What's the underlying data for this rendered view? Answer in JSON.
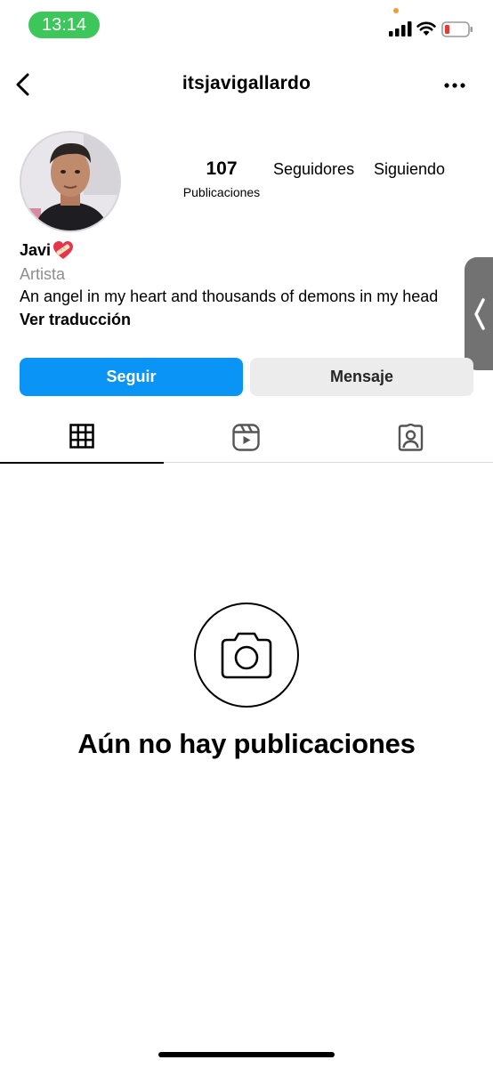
{
  "status_bar": {
    "time": "13:14",
    "colors": {
      "time_pill": "#3dc75a",
      "battery_low": "#e53935"
    }
  },
  "header": {
    "username": "itsjavigallardo",
    "back_icon": "chevron-left-icon",
    "more_icon": "more-horizontal-icon"
  },
  "profile": {
    "posts_count": "107",
    "posts_label": "Publicaciones",
    "followers_label": "Seguidores",
    "following_label": "Siguiendo",
    "display_name": "Javi",
    "display_name_emoji": "heart-with-bandage-icon",
    "category": "Artista",
    "bio": "An angel in my heart and thousands of demons in my head",
    "translate_link": "Ver traducción"
  },
  "actions": {
    "follow_label": "Seguir",
    "message_label": "Mensaje",
    "colors": {
      "follow_bg": "#0a95f6",
      "message_bg": "#ececec"
    }
  },
  "tabs": [
    {
      "icon": "grid-icon",
      "active": true
    },
    {
      "icon": "reels-icon",
      "active": false
    },
    {
      "icon": "tagged-icon",
      "active": false
    }
  ],
  "empty_state": {
    "icon": "camera-icon",
    "title": "Aún no hay publicaciones"
  }
}
